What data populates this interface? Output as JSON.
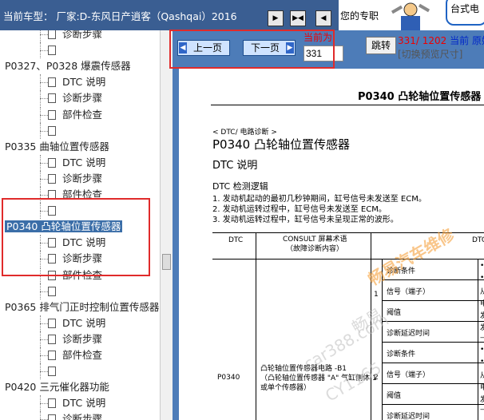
{
  "header": {
    "car_title": "当前车型：  厂家:D-东风日产逍客（Qashqai）2016",
    "banner_text": "您的专职",
    "badge_text": "台式电"
  },
  "sidebar": {
    "items": [
      {
        "label": "诊断步骤",
        "type": "leaf"
      },
      {
        "label": "",
        "type": "leaf"
      },
      {
        "label": "P0327、P0328 爆震传感器",
        "type": "group"
      },
      {
        "label": "DTC 说明",
        "type": "leaf"
      },
      {
        "label": "诊断步骤",
        "type": "leaf"
      },
      {
        "label": "部件检查",
        "type": "leaf"
      },
      {
        "label": "",
        "type": "leaf"
      },
      {
        "label": "P0335 曲轴位置传感器",
        "type": "group"
      },
      {
        "label": "DTC 说明",
        "type": "leaf"
      },
      {
        "label": "诊断步骤",
        "type": "leaf"
      },
      {
        "label": "部件检查",
        "type": "leaf"
      },
      {
        "label": "",
        "type": "leaf"
      },
      {
        "label": "P0340 凸轮轴位置传感器",
        "type": "group",
        "selected": true
      },
      {
        "label": "DTC 说明",
        "type": "leaf"
      },
      {
        "label": "诊断步骤",
        "type": "leaf"
      },
      {
        "label": "部件检查",
        "type": "leaf"
      },
      {
        "label": "",
        "type": "leaf"
      },
      {
        "label": "P0365 排气门正时控制位置传感器",
        "type": "group"
      },
      {
        "label": "DTC 说明",
        "type": "leaf"
      },
      {
        "label": "诊断步骤",
        "type": "leaf"
      },
      {
        "label": "部件检查",
        "type": "leaf"
      },
      {
        "label": "",
        "type": "leaf"
      },
      {
        "label": "P0420 三元催化器功能",
        "type": "group"
      },
      {
        "label": "DTC 说明",
        "type": "leaf"
      },
      {
        "label": "诊断步骤",
        "type": "leaf"
      }
    ]
  },
  "toolbar": {
    "prev_label": "上一页",
    "next_label": "下一页",
    "current_label": "当前为",
    "page_value": "331",
    "jump_label": "跳转",
    "page_count": "331/ 1202",
    "current_word": "当前",
    "original_word": "原始",
    "switch_size": "[切换预览尺寸]"
  },
  "document": {
    "header_title": "P0340 凸轮轴位置传感器",
    "breadcrumb": "< DTC/ 电路诊断 >",
    "title": "P0340 凸轮轴位置传感器",
    "section": "DTC 说明",
    "subsection": "DTC 检测逻辑",
    "lines": [
      "1.   发动机起动的最初几秒钟期间，缸号信号未发送至 ECM。",
      "2.   发动机运转过程中，缸号信号未发送至 ECM。",
      "3.   发动机运转过程中，缸号信号未呈现正常的波形。"
    ],
    "table": {
      "col_dtc": "DTC",
      "col_consult": "CONSULT 屏幕术语",
      "col_consult_sub": "（故障诊断内容）",
      "col_dtc2": "DTC",
      "dtc_code": "P0340",
      "term_1": "凸轮轴位置传感器电路 -B1",
      "term_2": "（凸轮轴位置传感器 \"A\" 气缸侧体 1",
      "term_3": "或单个传感器）",
      "rows": [
        "诊断条件",
        "信号（端子）",
        "阈值",
        "诊断延迟时间",
        "诊断条件",
        "信号（端子）",
        "阈值",
        "诊断延迟时间"
      ],
      "row_nums": [
        "1",
        "2"
      ],
      "right_bits": [
        "•",
        "•",
        "从",
        "电",
        "发",
        "发",
        "—",
        "•",
        "•",
        "从",
        "电",
        "发",
        "—"
      ]
    },
    "watermarks": [
      "畅易汽车维修",
      "畅易",
      "car388.com",
      "CY1165"
    ]
  },
  "colors": {
    "header_bg": "#3a5e92",
    "pane_bg": "#4d7cb8",
    "highlight": "#e02b2b",
    "selected_bg": "#3b6ea8"
  }
}
